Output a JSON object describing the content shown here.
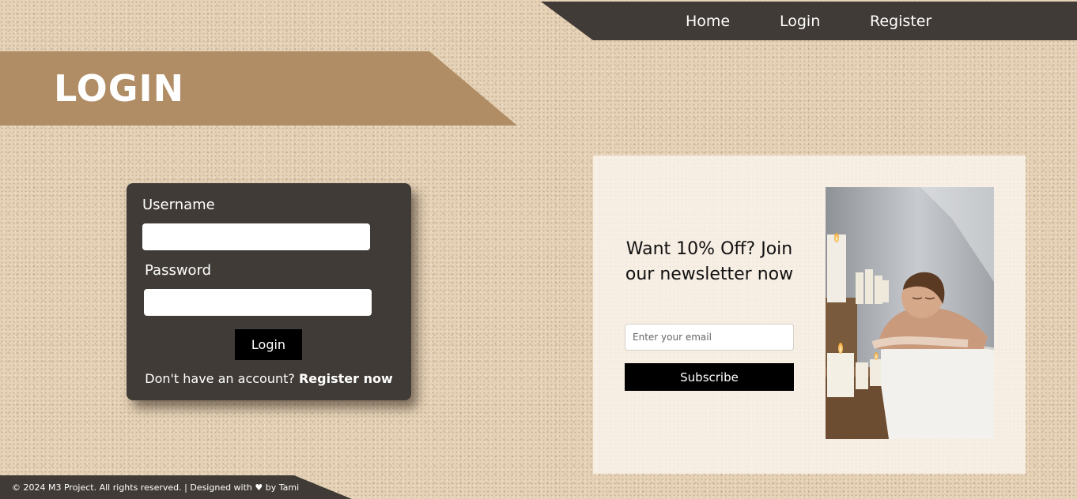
{
  "nav": {
    "items": [
      {
        "label": "Home"
      },
      {
        "label": "Login"
      },
      {
        "label": "Register"
      }
    ]
  },
  "banner": {
    "title": "LOGIN"
  },
  "login_form": {
    "username_label": "Username",
    "username_value": "",
    "password_label": "Password",
    "password_value": "",
    "login_button": "Login",
    "register_prompt": "Don't have an account?",
    "register_link": "Register now"
  },
  "newsletter": {
    "heading": "Want 10% Off? Join our newsletter now",
    "email_placeholder": "Enter your email",
    "subscribe_button": "Subscribe",
    "image_icon": "spa-massage-photo"
  },
  "footer": {
    "text": "© 2024 M3 Project. All rights reserved. | Designed with ♥ by Tami"
  },
  "colors": {
    "nav_bg": "#403b36",
    "banner_bg": "#b08d65",
    "card_bg": "#403b36",
    "button_bg": "#000000",
    "background": "#e6d2b6"
  }
}
